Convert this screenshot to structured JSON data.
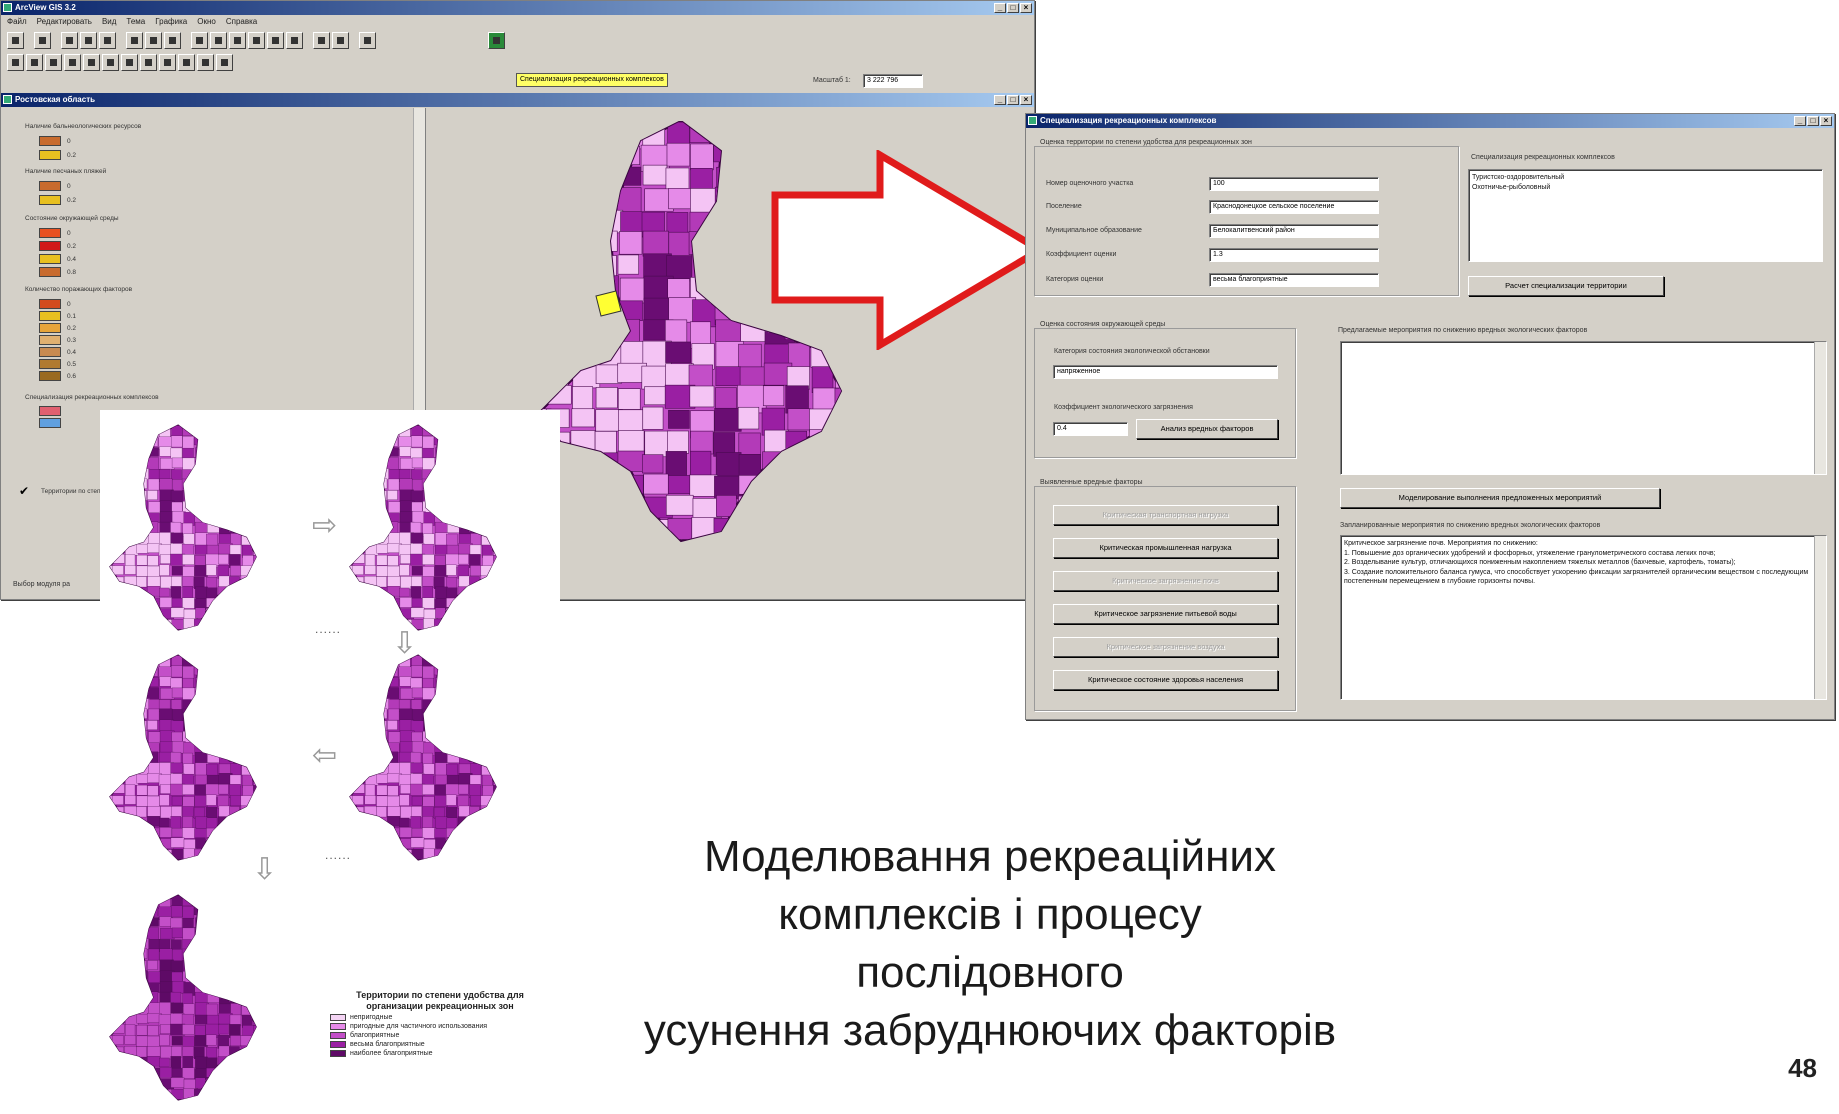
{
  "arcview": {
    "title": "ArcView GIS 3.2",
    "menu": [
      "Файл",
      "Редактировать",
      "Вид",
      "Тема",
      "Графика",
      "Окно",
      "Справка"
    ],
    "status_box": "Специализация рекреационных комплексов",
    "scale_label": "Масштаб 1:",
    "scale_value": "3 222 796",
    "view_title": "Ростовская область",
    "status_bar": "Выбор модуля ра",
    "legend_groups": [
      "Наличие бальнеологических ресурсов",
      "Наличие песчаных пляжей",
      "Состояние окружающей среды",
      "Количество поражающих факторов",
      "Специализация рекреационных комплексов",
      "Территории по степени удобства"
    ],
    "legend_values_1": [
      "0",
      "0.2"
    ],
    "legend_values_2": [
      "0",
      "0.2"
    ],
    "legend_values_3": [
      "0",
      "0.2",
      "0.4",
      "0.8"
    ],
    "legend_values_4": [
      "0",
      "0.1",
      "0.2",
      "0.3",
      "0.4",
      "0.5",
      "0.6"
    ]
  },
  "dialog": {
    "title": "Специализация рекреационных комплексов",
    "group1_title": "Оценка территории по степени удобства для рекреационных зон",
    "fields": [
      {
        "label": "Номер оценочного участка",
        "value": "100"
      },
      {
        "label": "Поселение",
        "value": "Краснодонецкое сельское поселение"
      },
      {
        "label": "Муниципальное образование",
        "value": "Белокалитвенский район"
      },
      {
        "label": "Коэффициент оценки",
        "value": "1.3"
      },
      {
        "label": "Категория оценки",
        "value": "весьма благоприятные"
      }
    ],
    "specialization_label": "Специализация рекреационных комплексов",
    "specialization_text": "Туристско-оздоровительный\nОхотничье-рыболовный",
    "calc_button": "Расчет специализации территории",
    "group2_title": "Оценка состояния окружающей среды",
    "eco_category_label": "Категория состояния экологической обстановки",
    "eco_category_value": "напряженное",
    "pollution_label": "Коэффициент экологического загрязнения",
    "pollution_value": "0.4",
    "analysis_button": "Анализ вредных факторов",
    "proposed_label": "Предлагаемые мероприятия по снижению вредных экологических факторов",
    "group3_title": "Выявленные вредные факторы",
    "factor_buttons": [
      {
        "label": "Критическая транспортная нагрузка",
        "enabled": false
      },
      {
        "label": "Критическая промышленная нагрузка",
        "enabled": true
      },
      {
        "label": "Критическое загрязнение почв",
        "enabled": false
      },
      {
        "label": "Критическое загрязнение питьевой воды",
        "enabled": true
      },
      {
        "label": "Критическое загрязнение воздуха",
        "enabled": false
      },
      {
        "label": "Критическое состояние здоровья населения",
        "enabled": true
      }
    ],
    "model_button": "Моделирование выполнения предложенных мероприятий",
    "planned_label": "Запланированные мероприятия по снижению вредных экологических факторов",
    "planned_text": "Критическое загрязнение почв. Мероприятия по снижению:\n1. Повышение доз органических удобрений и фосфорных, утяжеление гранулометрического состава легких почв;\n2. Возделывание культур, отличающихся пониженным накоплением тяжелых металлов (бахчевые, картофель, томаты);\n3. Создание положительного баланса гумуса, что способствует ускорению фиксации загрязнителей органическим веществом с последующим постепенным перемещением в глубокие горизонты почвы."
  },
  "legend": {
    "title": "Территории по степени удобства для организации рекреационных зон",
    "items": [
      {
        "label": "непригодные",
        "color": "#f4d4f4"
      },
      {
        "label": "пригодные для частичного использования",
        "color": "#e58ae8"
      },
      {
        "label": "благоприятные",
        "color": "#c34fc8"
      },
      {
        "label": "весьма благоприятные",
        "color": "#9a1fa3"
      },
      {
        "label": "наиболее благоприятные",
        "color": "#5e0a66"
      }
    ]
  },
  "dots": "......",
  "caption": [
    "Моделювання рекреаційних",
    "комплексів і процесу послідовного",
    "усунення забруднюючих факторів"
  ],
  "page_number": "48",
  "colors": {
    "win_gray": "#d4d0c8",
    "title_blue": "#0a246a",
    "arrow_red": "#e01b1b",
    "map_light": "#e58ae8",
    "map_mid": "#b33ab8",
    "map_dark": "#6a0d73"
  }
}
